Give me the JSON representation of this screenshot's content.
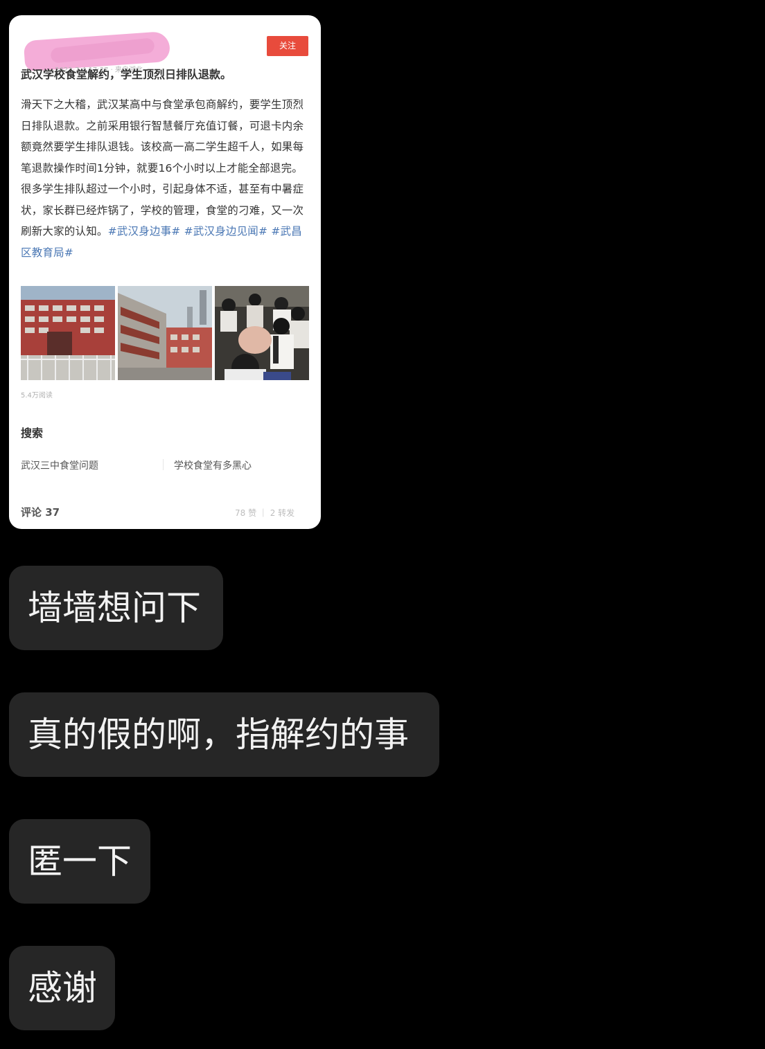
{
  "shared_post": {
    "meta": "2023-7-4 17:37 · 来自湖北",
    "follow_label": "关注",
    "title": "武汉学校食堂解约，学生顶烈日排队退款。",
    "body_text": "滑天下之大稽，武汉某高中与食堂承包商解约，要学生顶烈日排队退款。之前采用银行智慧餐厅充值订餐，可退卡内余额竟然要学生排队退钱。该校高一高二学生超千人，如果每笔退款操作时间1分钟，就要16个小时以上才能全部退完。很多学生排队超过一个小时，引起身体不适，甚至有中暑症状，家长群已经炸锅了，学校的管理，食堂的刁难，又一次刷新大家的认知。",
    "hashtags": "#武汉身边事# #武汉身边见闻# #武昌区教育局#",
    "photos": [
      {
        "icon": "school-building-photo-icon"
      },
      {
        "icon": "school-building-side-photo-icon"
      },
      {
        "icon": "students-queue-photo-icon"
      }
    ],
    "views": "5.4万阅读",
    "search_heading": "搜索",
    "search_suggestions": [
      "武汉三中食堂问题",
      "学校食堂有多黑心"
    ],
    "comments": "评论 37",
    "likes_reposts": "78 赞 ｜ 2 转发",
    "accent_color": "#e84b3c",
    "redaction_color": "#f3a9d6"
  },
  "messages": [
    {
      "text": "墙墙想问下"
    },
    {
      "text": "真的假的啊，指解约的事"
    },
    {
      "text": "匿一下"
    },
    {
      "text": "感谢"
    }
  ]
}
